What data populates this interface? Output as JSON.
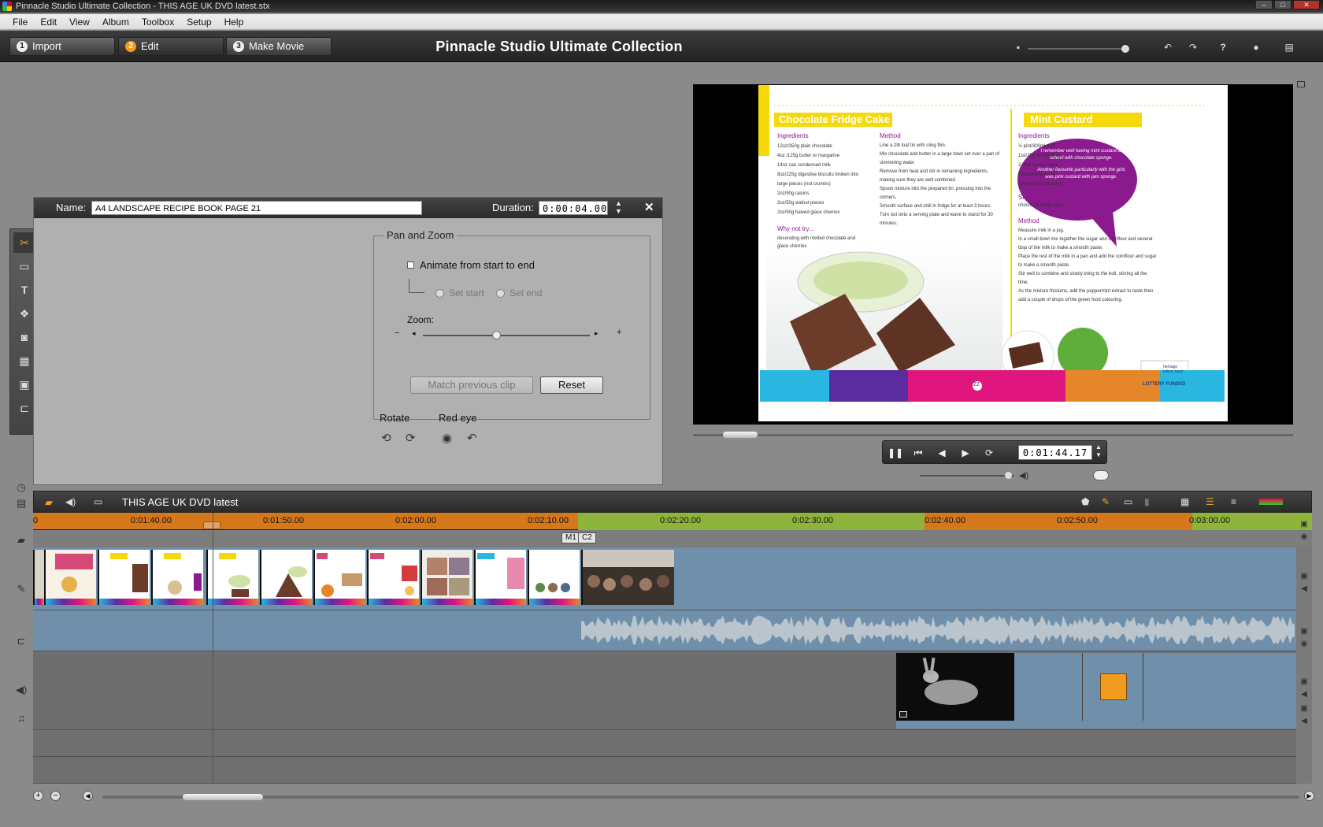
{
  "window": {
    "title": "Pinnacle Studio Ultimate Collection - THIS AGE UK DVD latest.stx"
  },
  "menu": [
    "File",
    "Edit",
    "View",
    "Album",
    "Toolbox",
    "Setup",
    "Help"
  ],
  "modes": [
    {
      "num": "1",
      "label": "Import"
    },
    {
      "num": "2",
      "label": "Edit"
    },
    {
      "num": "3",
      "label": "Make Movie"
    }
  ],
  "app_title": "Pinnacle Studio Ultimate Collection",
  "editor": {
    "name_label": "Name:",
    "name_value": "A4 LANDSCAPE RECIPE BOOK PAGE 21",
    "duration_label": "Duration:",
    "duration_value": "0:00:04.00",
    "panzoom": {
      "title": "Pan and Zoom",
      "animate_label": "Animate from start to end",
      "set_start": "Set start",
      "set_end": "Set end",
      "zoom_label": "Zoom:",
      "zoom_level": 0.44,
      "match_button": "Match previous clip",
      "reset_button": "Reset"
    },
    "rotate_label": "Rotate",
    "redeye_label": "Red eye"
  },
  "preview": {
    "left_title": "Chocolate Fridge Cake",
    "right_title": "Mint Custard",
    "ingredients_label": "Ingredients",
    "method_label": "Method",
    "why_label": "Why not try...",
    "serve_label": "Serve with...",
    "serve_text": "chocolate fridge cake",
    "why_text": "decorating with melted chocolate and glace cherries",
    "left_ingredients": [
      "12oz/350g plain chocolate",
      "4oz /125g butter or margarine",
      "14oz can condensed milk",
      "8oz/225g digestive biscuits broken into large pieces (not crumbs)",
      "2oz/50g raisins",
      "2oz/50g walnut pieces",
      "2oz/50g halved glace cherries"
    ],
    "left_method": [
      "Line a 2lb loaf tin with cling film.",
      "Mix chocolate and butter in a large bowl set over a pan of simmering water.",
      "Remove from heat and stir in remaining ingredients, making sure they are well combined.",
      "Spoon mixture into the prepared tin, pressing into the corners.",
      "Smooth surface and chill in fridge for at least 3 hours.",
      "Turn out onto a serving plate and leave to stand for 30 minutes."
    ],
    "right_ingredients": [
      "½ pint/300ml milk",
      "1oz/25g of cornflour",
      "2 tbsp caster sugar",
      "Peppermint extract",
      "Green food colouring"
    ],
    "right_method": [
      "Measure milk in a jug.",
      "In a small bowl mix together the sugar and cornflour and several tbsp of the milk to make a smooth paste.",
      "Place the rest of the milk in a pan and add the cornflour and sugar to make a smooth paste.",
      "Stir well to combine and slowly bring to the boil, stirring all the time.",
      "As the mixture thickens, add the peppermint extract to taste then add a couple of drops of the green food colouring."
    ],
    "quote1": "I remember well having mint custard at school with chocolate sponge.",
    "quote2": "Another favourite particularly with the girls was pink custard with jam sponge.",
    "page_num": "22",
    "lottery": "LOTTERY FUNDED",
    "heritage": "heritage lottery fund",
    "timecode": "0:01:44.17",
    "scrub_position": 0.05,
    "volume_level": 0.93
  },
  "timeline": {
    "project_name": "THIS AGE UK DVD latest",
    "ticks": [
      "0:01:40.00",
      "0:01:50.00",
      "0:02:00.00",
      "0:02:10.00",
      "0:02:20.00",
      "0:02:30.00",
      "0:02:40.00",
      "0:02:50.00",
      "0:03:00.00"
    ],
    "ruler_start_label": "0",
    "markers": [
      "M1",
      "C2"
    ]
  },
  "colors": {
    "accent_orange": "#d5781c",
    "ruler_green": "#8fb43b",
    "track_blue": "#6f8fab",
    "recipe_yellow": "#f5d90a",
    "recipe_purple": "#8b1a8e"
  }
}
